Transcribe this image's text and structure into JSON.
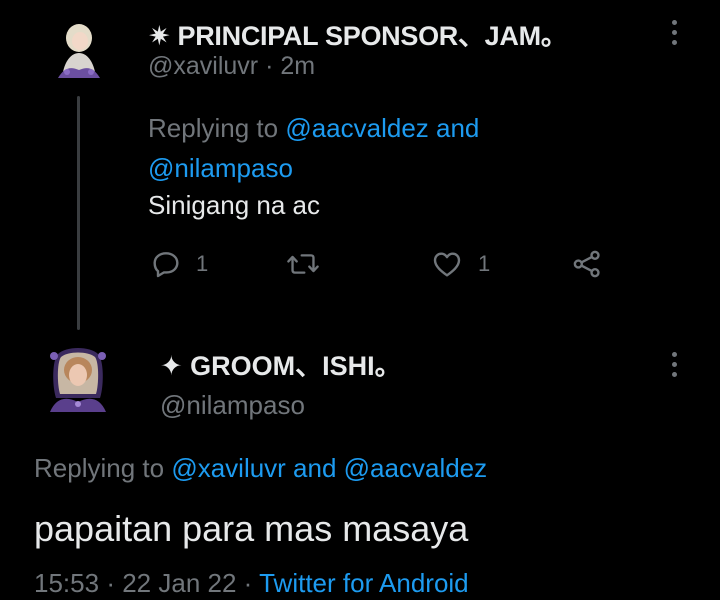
{
  "first_tweet": {
    "display_name": "✷ PRINCIPAL SPONSOR、JAM。",
    "handle": "@xaviluvr",
    "separator": "·",
    "time": "2m",
    "replying_prefix": "Replying to",
    "replying_targets": "@aacvaldez and @nilampaso",
    "text": "Sinigang na ac",
    "reply_count": "1",
    "like_count": "1"
  },
  "second_tweet": {
    "display_name": "✦ GROOM、ISHI。",
    "handle": "@nilampaso",
    "replying_prefix": "Replying to",
    "replying_targets": "@xaviluvr and @aacvaldez",
    "text": "papaitan para mas masaya",
    "time": "15:53",
    "separator": "·",
    "date": "22 Jan 22",
    "client": "Twitter for Android"
  },
  "colors": {
    "background": "#000000",
    "primary_text": "#e7e9ea",
    "secondary_text": "#71767b",
    "link": "#1d9bf0"
  },
  "icons": {
    "reply": "reply-icon",
    "retweet": "retweet-icon",
    "like": "heart-icon",
    "share": "share-icon",
    "more": "more-vertical-icon"
  }
}
